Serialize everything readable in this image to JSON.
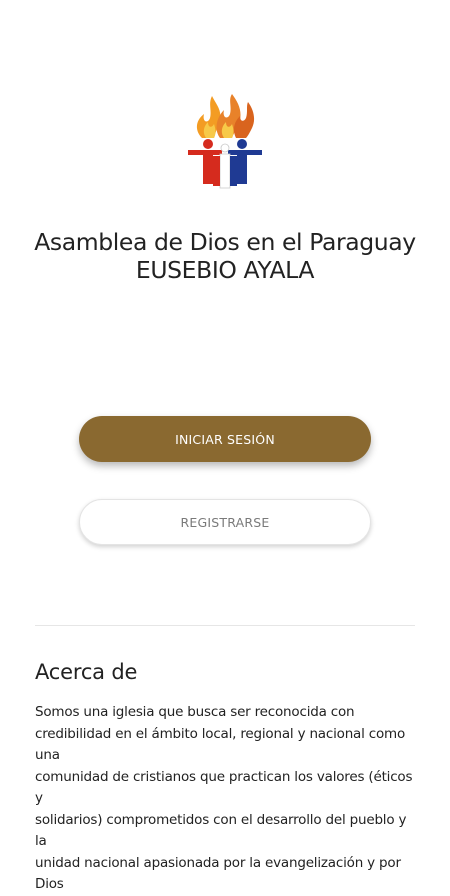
{
  "header": {
    "logo_icon": "asamblea-de-dios-paraguay-logo",
    "title_line1": "Asamblea de Dios en el Paraguay",
    "title_line2": "EUSEBIO AYALA"
  },
  "actions": {
    "login_label": "INICIAR SESIÓN",
    "register_label": "REGISTRARSE"
  },
  "about": {
    "heading": "Acerca de",
    "text": "Somos una iglesia que busca ser  reconocida con\ncredibilidad en el ámbito local, regional y nacional como una\ncomunidad de cristianos que practican los valores (éticos y\nsolidarios) comprometidos con el desarrollo del pueblo y la\nunidad nacional apasionada por la evangelización y por Dios"
  },
  "colors": {
    "primary_button": "#8a6930",
    "flame_orange": "#e8822a",
    "flag_red": "#d52b1e",
    "flag_blue": "#1f3a93"
  }
}
